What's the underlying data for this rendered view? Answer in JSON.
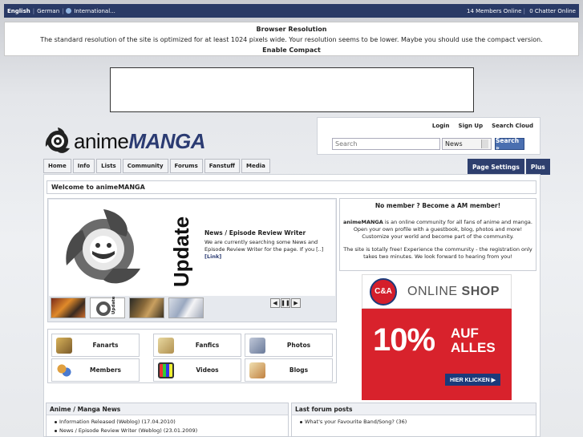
{
  "topbar": {
    "languages": [
      "English",
      "German",
      "International..."
    ],
    "members_online": "14 Members Online",
    "chatter_online": "0 Chatter Online"
  },
  "notice": {
    "title": "Browser Resolution",
    "text": "The standard resolution of the site is optimized for at least 1024 pixels wide. Your resolution seems to be lower. Maybe you should use the compact version.",
    "link": "Enable Compact"
  },
  "logo": {
    "part1": "anime",
    "part2": "MANGA"
  },
  "search": {
    "links": [
      "Login",
      "Sign Up",
      "Search Cloud"
    ],
    "placeholder": "Search",
    "select_value": "News",
    "button": "Search »"
  },
  "nav": {
    "tabs": [
      "Home",
      "Info",
      "Lists",
      "Community",
      "Forums",
      "Fanstuff",
      "Media"
    ],
    "right": [
      "Page Settings",
      "Plus"
    ]
  },
  "welcome": "Welcome to animeMANGA",
  "feature": {
    "update_word": "Update",
    "heading": "News / Episode Review Writer",
    "text": "We are currently searching some News and Episode Review Writer for the page. If you [..]",
    "link": "[Link]",
    "thumb_label": "Update",
    "controls": [
      "◀",
      "❚❚",
      "▶"
    ]
  },
  "grid": [
    "Fanarts",
    "Fanfics",
    "Photos",
    "Members",
    "Videos",
    "Blogs"
  ],
  "member_box": {
    "heading": "No member ? Become a AM member!",
    "brand": "animeMANGA",
    "p1": " is an online community for all fans of anime and manga. Open your own profile with a guestbook, blog, photos and more! Customize your world and become part of the community.",
    "p2": "The site is totally free! Experience the community - the registration only takes two minutes. We look forward to hearing from you!"
  },
  "ad": {
    "logo": "C&A",
    "shop_1": "ONLINE",
    "shop_2": "SHOP",
    "big": "10%",
    "auf_1": "AUF",
    "auf_2": "ALLES",
    "cta": "HIER KLICKEN ▶"
  },
  "news": {
    "title": "Anime / Manga News",
    "items": [
      "Information Released (Weblog) (17.04.2010)",
      "News / Episode Review Writer (Weblog) (23.01.2009)"
    ]
  },
  "forum": {
    "title": "Last forum posts",
    "items": [
      "What's your Favourite Band/Song? (36)"
    ]
  },
  "colors": {
    "topbar": "#2a3a66",
    "brand_blue": "#2b3b72",
    "ad_red": "#d8222c"
  }
}
